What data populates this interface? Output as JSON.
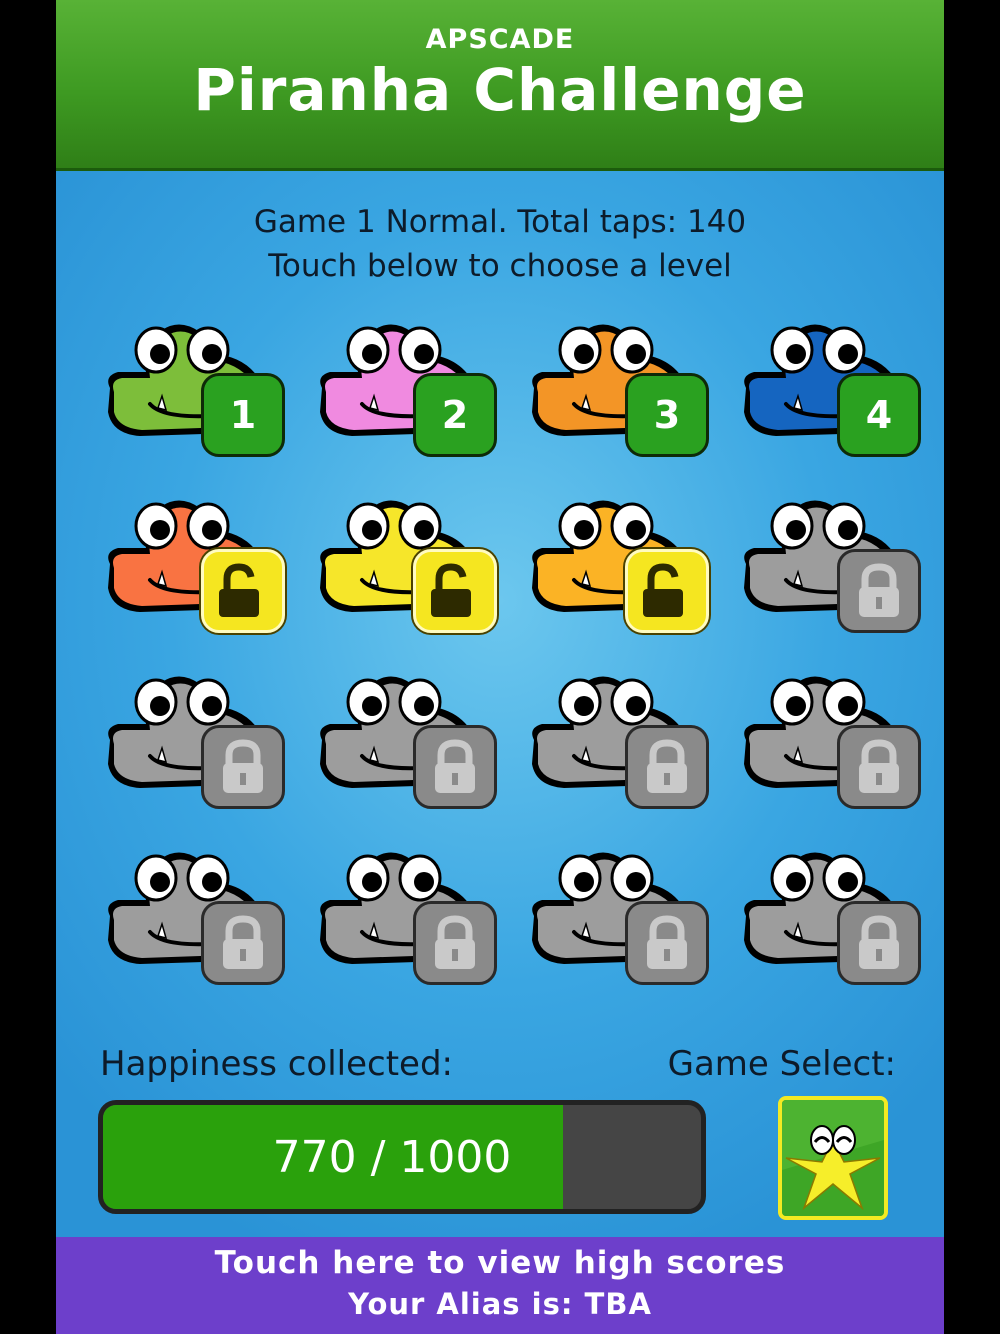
{
  "header": {
    "brand": "APSCADE",
    "title": "Piranha Challenge"
  },
  "info": {
    "line1": "Game 1 Normal. Total taps: 140",
    "line2": "Touch below to choose a level"
  },
  "levels": [
    {
      "color": "#7dbe3a",
      "state": "number",
      "label": "1"
    },
    {
      "color": "#f08ae0",
      "state": "number",
      "label": "2"
    },
    {
      "color": "#f39526",
      "state": "number",
      "label": "3"
    },
    {
      "color": "#1565c0",
      "state": "number",
      "label": "4"
    },
    {
      "color": "#f97342",
      "state": "unlocked"
    },
    {
      "color": "#f6e62a",
      "state": "unlocked"
    },
    {
      "color": "#fbb325",
      "state": "unlocked"
    },
    {
      "color": "#9d9d9d",
      "state": "locked"
    },
    {
      "color": "#9d9d9d",
      "state": "locked"
    },
    {
      "color": "#9d9d9d",
      "state": "locked"
    },
    {
      "color": "#9d9d9d",
      "state": "locked"
    },
    {
      "color": "#9d9d9d",
      "state": "locked"
    },
    {
      "color": "#9d9d9d",
      "state": "locked"
    },
    {
      "color": "#9d9d9d",
      "state": "locked"
    },
    {
      "color": "#9d9d9d",
      "state": "locked"
    },
    {
      "color": "#9d9d9d",
      "state": "locked"
    }
  ],
  "happiness": {
    "label": "Happiness collected:",
    "text": "770 / 1000",
    "value": 770,
    "max": 1000
  },
  "game_select": {
    "label": "Game Select:"
  },
  "footer": {
    "line1": "Touch here to view high scores",
    "line2": "Your Alias is: TBA"
  }
}
